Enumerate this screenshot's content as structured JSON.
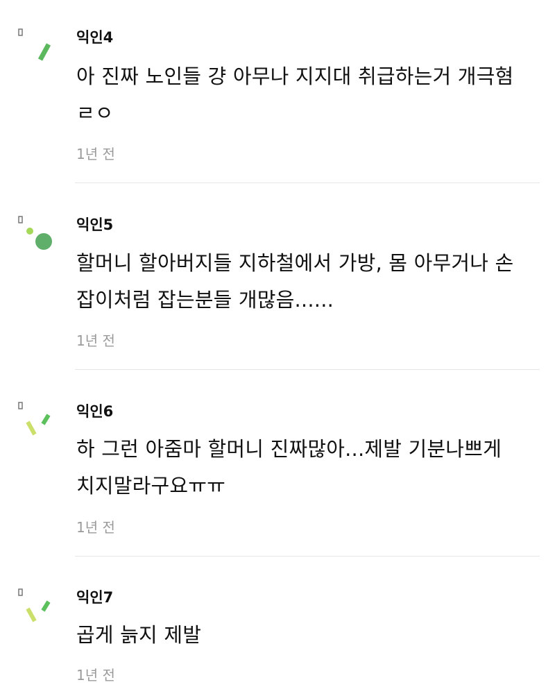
{
  "comments": [
    {
      "author": "익인4",
      "lines": [
        "아 진짜 노인들 걍 아무나 지지대 취급하는거 개극혐",
        "ㄹㅇ"
      ],
      "time": "1년 전",
      "avatar_icon": "green-dash-avatar-icon",
      "avatar_colors": [
        "#5cb85c"
      ]
    },
    {
      "author": "익인5",
      "lines": [
        "할머니 할아버지들 지하철에서 가방, 몸 아무거나 손",
        "잡이처럼 잡는분들 개많음......"
      ],
      "time": "1년 전",
      "avatar_icon": "green-dots-avatar-icon",
      "avatar_colors": [
        "#a6d95a",
        "#5fae6a"
      ]
    },
    {
      "author": "익인6",
      "lines": [
        "하 그런 아줌마 할머니 진짜많아...제발 기분나쁘게",
        "치지말라구요ㅠㅠ"
      ],
      "time": "1년 전",
      "avatar_icon": "check-dash-avatar-icon",
      "avatar_colors": [
        "#cbe06a",
        "#5cc05c"
      ]
    },
    {
      "author": "익인7",
      "lines": [
        "곱게 늙지 제발"
      ],
      "time": "1년 전",
      "avatar_icon": "check-dash-avatar-icon",
      "avatar_colors": [
        "#cbe06a",
        "#5cc05c"
      ]
    }
  ]
}
